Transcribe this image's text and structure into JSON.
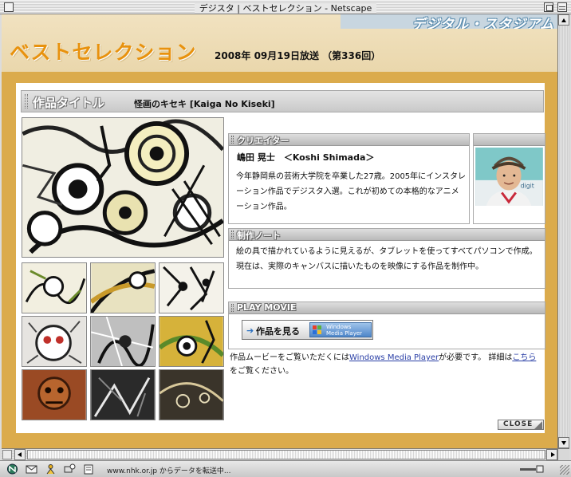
{
  "window": {
    "title": "デジスタ | ベストセレクション - Netscape"
  },
  "header": {
    "brand": "デジタル・スタジアム",
    "section_title": "ベストセレクション",
    "broadcast": "2008年 09月19日放送 （第336回）"
  },
  "work": {
    "label": "作品タイトル",
    "title": "怪画のキセキ [Kaiga No Kiseki]"
  },
  "creator": {
    "heading": "クリエイター",
    "name": "嶋田 晃士　＜Koshi Shimada＞",
    "bio": "今年静岡県の芸術大学院を卒業した27歳。2005年にインスタレーション作品でデジスタ入選。これが初めての本格的なアニメーション作品。",
    "photo_caption": "digit"
  },
  "notes": {
    "heading": "制作ノート",
    "text": "絵の具で描かれているように見えるが、タブレットを使ってすべてパソコンで作成。現在は、実際のキャンバスに描いたものを映像にする作品を制作中。"
  },
  "movie": {
    "heading": "PLAY MOVIE",
    "button_label": "作品を見る",
    "player_line1": "Windows",
    "player_line2": "Media Player",
    "note_prefix": "作品ムービーをご覧いただくには",
    "note_link": "Windows Media Player",
    "note_middle": "が必要です。 詳細は",
    "note_link2": "こちら",
    "note_suffix": "をご覧ください。"
  },
  "close_label": "CLOSE",
  "status": {
    "text": "www.nhk.or.jp からデータを転送中..."
  },
  "colors": {
    "accent_orange": "#e8920e",
    "frame_gold": "#dbab4c",
    "header_cream": "#f1e2c0",
    "brand_blue": "#5f8fb0",
    "link": "#2a3fa6"
  }
}
